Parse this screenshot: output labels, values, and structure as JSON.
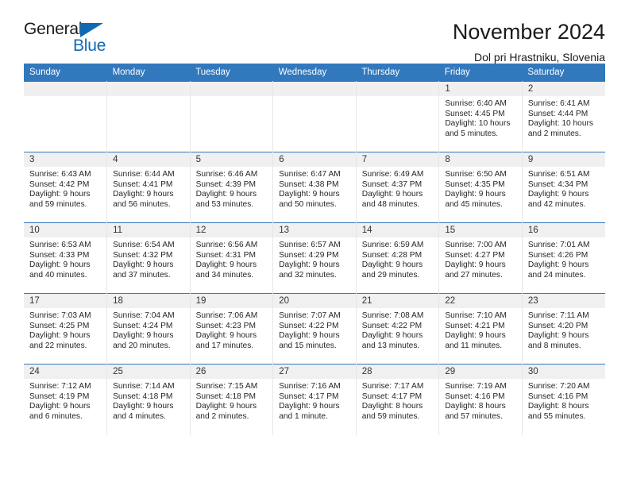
{
  "brand": {
    "line1": "General",
    "line2": "Blue",
    "accent_color": "#1268b3"
  },
  "header": {
    "month_title": "November 2024",
    "location": "Dol pri Hrastniku, Slovenia",
    "header_bg_color": "#3278bd"
  },
  "weekday_headers": [
    "Sunday",
    "Monday",
    "Tuesday",
    "Wednesday",
    "Thursday",
    "Friday",
    "Saturday"
  ],
  "labels": {
    "sunrise": "Sunrise:",
    "sunset": "Sunset:",
    "daylight": "Daylight:"
  },
  "weeks": [
    [
      {
        "day": "",
        "empty": true
      },
      {
        "day": "",
        "empty": true
      },
      {
        "day": "",
        "empty": true
      },
      {
        "day": "",
        "empty": true
      },
      {
        "day": "",
        "empty": true
      },
      {
        "day": "1",
        "sunrise": "Sunrise: 6:40 AM",
        "sunset": "Sunset: 4:45 PM",
        "daylight": "Daylight: 10 hours and 5 minutes."
      },
      {
        "day": "2",
        "sunrise": "Sunrise: 6:41 AM",
        "sunset": "Sunset: 4:44 PM",
        "daylight": "Daylight: 10 hours and 2 minutes."
      }
    ],
    [
      {
        "day": "3",
        "sunrise": "Sunrise: 6:43 AM",
        "sunset": "Sunset: 4:42 PM",
        "daylight": "Daylight: 9 hours and 59 minutes."
      },
      {
        "day": "4",
        "sunrise": "Sunrise: 6:44 AM",
        "sunset": "Sunset: 4:41 PM",
        "daylight": "Daylight: 9 hours and 56 minutes."
      },
      {
        "day": "5",
        "sunrise": "Sunrise: 6:46 AM",
        "sunset": "Sunset: 4:39 PM",
        "daylight": "Daylight: 9 hours and 53 minutes."
      },
      {
        "day": "6",
        "sunrise": "Sunrise: 6:47 AM",
        "sunset": "Sunset: 4:38 PM",
        "daylight": "Daylight: 9 hours and 50 minutes."
      },
      {
        "day": "7",
        "sunrise": "Sunrise: 6:49 AM",
        "sunset": "Sunset: 4:37 PM",
        "daylight": "Daylight: 9 hours and 48 minutes."
      },
      {
        "day": "8",
        "sunrise": "Sunrise: 6:50 AM",
        "sunset": "Sunset: 4:35 PM",
        "daylight": "Daylight: 9 hours and 45 minutes."
      },
      {
        "day": "9",
        "sunrise": "Sunrise: 6:51 AM",
        "sunset": "Sunset: 4:34 PM",
        "daylight": "Daylight: 9 hours and 42 minutes."
      }
    ],
    [
      {
        "day": "10",
        "sunrise": "Sunrise: 6:53 AM",
        "sunset": "Sunset: 4:33 PM",
        "daylight": "Daylight: 9 hours and 40 minutes."
      },
      {
        "day": "11",
        "sunrise": "Sunrise: 6:54 AM",
        "sunset": "Sunset: 4:32 PM",
        "daylight": "Daylight: 9 hours and 37 minutes."
      },
      {
        "day": "12",
        "sunrise": "Sunrise: 6:56 AM",
        "sunset": "Sunset: 4:31 PM",
        "daylight": "Daylight: 9 hours and 34 minutes."
      },
      {
        "day": "13",
        "sunrise": "Sunrise: 6:57 AM",
        "sunset": "Sunset: 4:29 PM",
        "daylight": "Daylight: 9 hours and 32 minutes."
      },
      {
        "day": "14",
        "sunrise": "Sunrise: 6:59 AM",
        "sunset": "Sunset: 4:28 PM",
        "daylight": "Daylight: 9 hours and 29 minutes."
      },
      {
        "day": "15",
        "sunrise": "Sunrise: 7:00 AM",
        "sunset": "Sunset: 4:27 PM",
        "daylight": "Daylight: 9 hours and 27 minutes."
      },
      {
        "day": "16",
        "sunrise": "Sunrise: 7:01 AM",
        "sunset": "Sunset: 4:26 PM",
        "daylight": "Daylight: 9 hours and 24 minutes."
      }
    ],
    [
      {
        "day": "17",
        "sunrise": "Sunrise: 7:03 AM",
        "sunset": "Sunset: 4:25 PM",
        "daylight": "Daylight: 9 hours and 22 minutes."
      },
      {
        "day": "18",
        "sunrise": "Sunrise: 7:04 AM",
        "sunset": "Sunset: 4:24 PM",
        "daylight": "Daylight: 9 hours and 20 minutes."
      },
      {
        "day": "19",
        "sunrise": "Sunrise: 7:06 AM",
        "sunset": "Sunset: 4:23 PM",
        "daylight": "Daylight: 9 hours and 17 minutes."
      },
      {
        "day": "20",
        "sunrise": "Sunrise: 7:07 AM",
        "sunset": "Sunset: 4:22 PM",
        "daylight": "Daylight: 9 hours and 15 minutes."
      },
      {
        "day": "21",
        "sunrise": "Sunrise: 7:08 AM",
        "sunset": "Sunset: 4:22 PM",
        "daylight": "Daylight: 9 hours and 13 minutes."
      },
      {
        "day": "22",
        "sunrise": "Sunrise: 7:10 AM",
        "sunset": "Sunset: 4:21 PM",
        "daylight": "Daylight: 9 hours and 11 minutes."
      },
      {
        "day": "23",
        "sunrise": "Sunrise: 7:11 AM",
        "sunset": "Sunset: 4:20 PM",
        "daylight": "Daylight: 9 hours and 8 minutes."
      }
    ],
    [
      {
        "day": "24",
        "sunrise": "Sunrise: 7:12 AM",
        "sunset": "Sunset: 4:19 PM",
        "daylight": "Daylight: 9 hours and 6 minutes."
      },
      {
        "day": "25",
        "sunrise": "Sunrise: 7:14 AM",
        "sunset": "Sunset: 4:18 PM",
        "daylight": "Daylight: 9 hours and 4 minutes."
      },
      {
        "day": "26",
        "sunrise": "Sunrise: 7:15 AM",
        "sunset": "Sunset: 4:18 PM",
        "daylight": "Daylight: 9 hours and 2 minutes."
      },
      {
        "day": "27",
        "sunrise": "Sunrise: 7:16 AM",
        "sunset": "Sunset: 4:17 PM",
        "daylight": "Daylight: 9 hours and 1 minute."
      },
      {
        "day": "28",
        "sunrise": "Sunrise: 7:17 AM",
        "sunset": "Sunset: 4:17 PM",
        "daylight": "Daylight: 8 hours and 59 minutes."
      },
      {
        "day": "29",
        "sunrise": "Sunrise: 7:19 AM",
        "sunset": "Sunset: 4:16 PM",
        "daylight": "Daylight: 8 hours and 57 minutes."
      },
      {
        "day": "30",
        "sunrise": "Sunrise: 7:20 AM",
        "sunset": "Sunset: 4:16 PM",
        "daylight": "Daylight: 8 hours and 55 minutes."
      }
    ]
  ]
}
